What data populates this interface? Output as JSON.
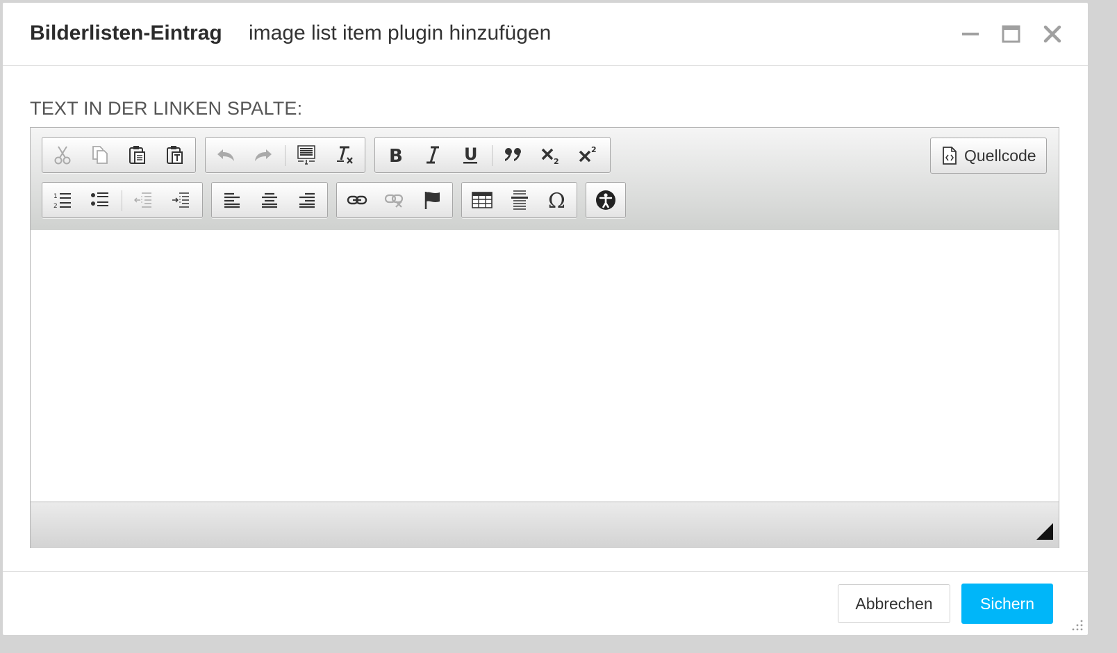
{
  "dialog": {
    "title": "Bilderlisten-Eintrag",
    "subtitle": "image list item plugin hinzufügen",
    "window_controls": [
      "minimize-icon",
      "maximize-icon",
      "close-icon"
    ]
  },
  "field": {
    "label": "TEXT IN DER LINKEN SPALTE:"
  },
  "editor": {
    "toolbar": {
      "row1": [
        [
          "cut-icon",
          "copy-icon",
          "paste-icon",
          "paste-text-icon"
        ],
        [
          "undo-icon",
          "redo-icon",
          "select-all-icon",
          "remove-format-icon"
        ],
        [
          "bold-icon",
          "italic-icon",
          "underline-icon",
          "blockquote-icon",
          "subscript-icon",
          "superscript-icon"
        ]
      ],
      "row2": [
        [
          "numbered-list-icon",
          "bulleted-list-icon",
          "outdent-icon",
          "indent-icon"
        ],
        [
          "align-left-icon",
          "align-center-icon",
          "align-right-icon"
        ],
        [
          "link-icon",
          "unlink-icon",
          "anchor-icon"
        ],
        [
          "table-icon",
          "horizontal-line-icon",
          "special-char-icon"
        ],
        [
          "accessibility-icon"
        ]
      ],
      "source_label": "Quellcode"
    },
    "content": ""
  },
  "footer": {
    "cancel_label": "Abbrechen",
    "save_label": "Sichern"
  },
  "colors": {
    "accent": "#00b6f9",
    "icon": "#333333",
    "icon_disabled": "#aaaaaa"
  }
}
